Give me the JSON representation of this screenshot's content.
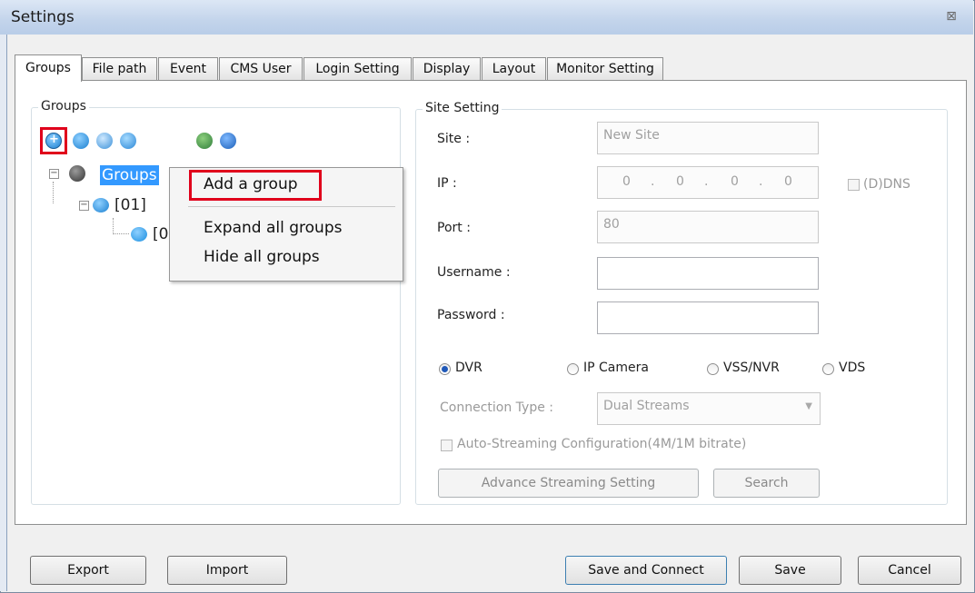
{
  "window": {
    "title": "Settings",
    "close_glyph": "⊠"
  },
  "tabs": [
    "Groups",
    "File path",
    "Event",
    "CMS User",
    "Login Setting",
    "Display",
    "Layout",
    "Monitor Setting"
  ],
  "groups_panel": {
    "legend": "Groups",
    "toolbar_icons": [
      "add-group-icon",
      "add-site-icon",
      "edit-group-icon",
      "remove-site-icon",
      "expand-all-icon",
      "collapse-all-icon"
    ],
    "tree": {
      "root": "Groups",
      "child": "[01]",
      "grandchild": "[0"
    }
  },
  "context_menu": {
    "items": [
      "Add a group",
      "Expand all groups",
      "Hide all groups"
    ]
  },
  "site_setting": {
    "legend": "Site Setting",
    "site_label": "Site :",
    "site_value": "New Site",
    "ip_label": "IP :",
    "ip_octets": [
      "0",
      "0",
      "0",
      "0"
    ],
    "ddns_label": "(D)DNS",
    "port_label": "Port :",
    "port_value": "80",
    "username_label": "Username :",
    "password_label": "Password :",
    "device_types": [
      "DVR",
      "IP Camera",
      "VSS/NVR",
      "VDS"
    ],
    "selected_device": "DVR",
    "connection_type_label": "Connection Type :",
    "connection_type_value": "Dual Streams",
    "auto_streaming_label": "Auto-Streaming Configuration(4M/1M bitrate)",
    "advance_button": "Advance Streaming Setting",
    "search_button": "Search"
  },
  "footer": {
    "export": "Export",
    "import": "Import",
    "save_connect": "Save and Connect",
    "save": "Save",
    "cancel": "Cancel"
  },
  "colors": {
    "highlight_red": "#e0001b",
    "selection_blue": "#3399ff",
    "icon_blue": "#1a8fe0"
  }
}
